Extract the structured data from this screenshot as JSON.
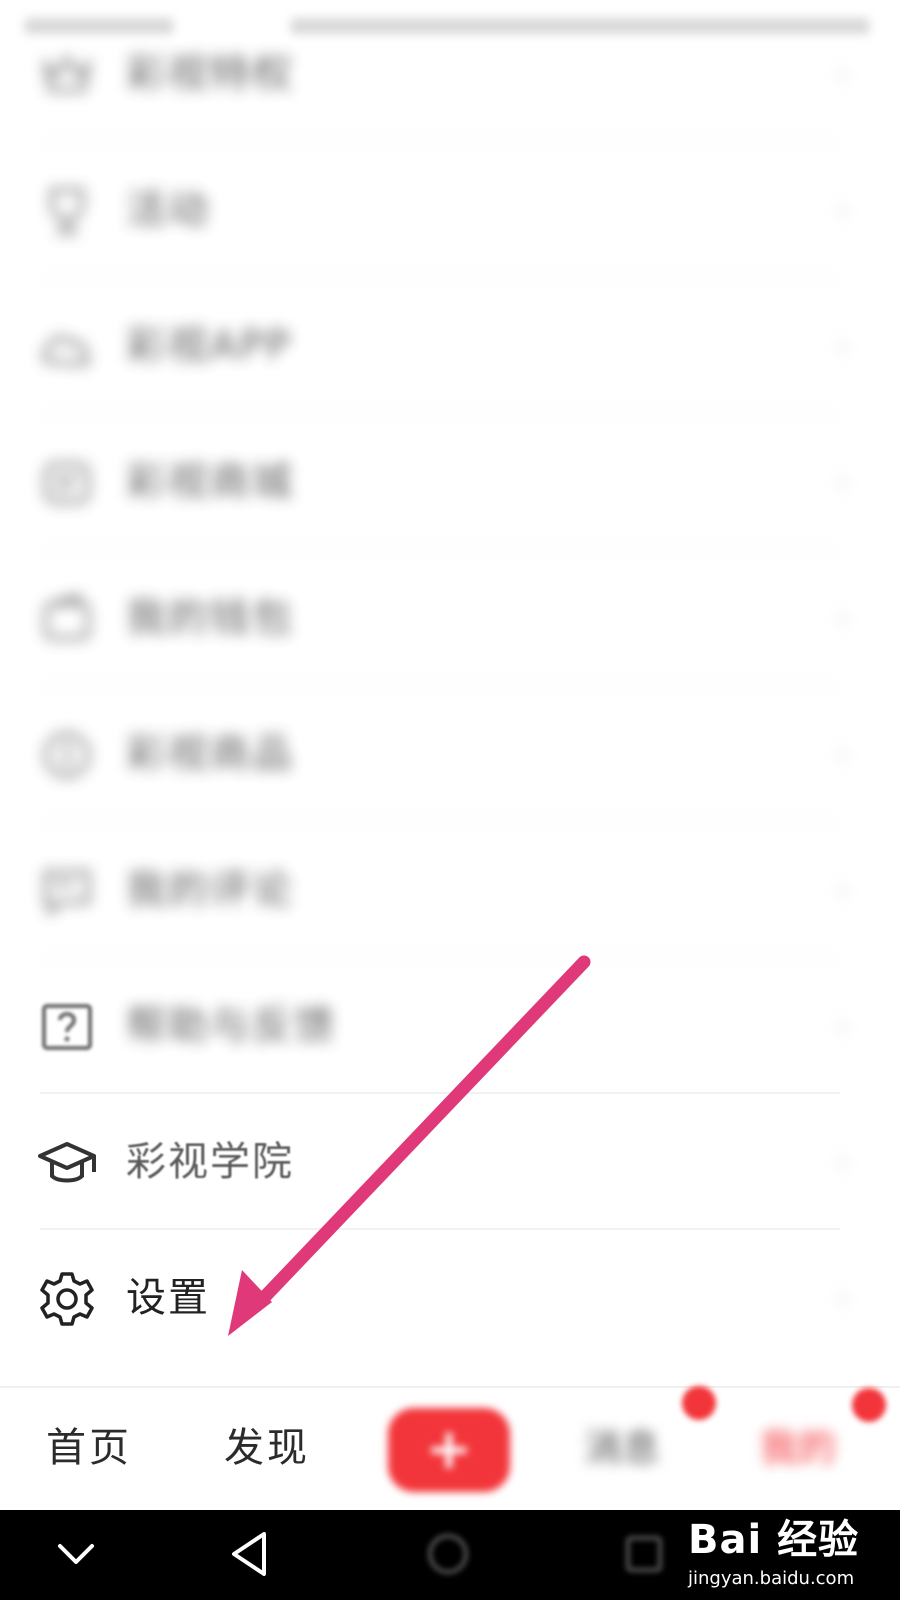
{
  "menu": {
    "items": [
      {
        "label": "彩视特权",
        "icon": "crown-icon",
        "clarity": "blurred"
      },
      {
        "label": "活动",
        "icon": "trophy-icon",
        "clarity": "blurred"
      },
      {
        "label": "彩视APP",
        "icon": "cloud-icon",
        "clarity": "blurred"
      },
      {
        "label": "彩视商城",
        "icon": "store-icon",
        "clarity": "blurred"
      },
      {
        "label": "我的钱包",
        "icon": "wallet-icon",
        "clarity": "blurred"
      },
      {
        "label": "彩视商品",
        "icon": "coin-icon",
        "clarity": "blurred"
      },
      {
        "label": "我的评论",
        "icon": "comment-icon",
        "clarity": "blurred"
      },
      {
        "label": "帮助与反馈",
        "icon": "help-icon",
        "clarity": "blurred"
      },
      {
        "label": "彩视学院",
        "icon": "graduation-cap-icon",
        "clarity": "soft"
      },
      {
        "label": "设置",
        "icon": "gear-icon",
        "clarity": "sharp"
      }
    ],
    "chevron": "›"
  },
  "tabbar": {
    "home": "首页",
    "discover": "发现",
    "create": "+",
    "messages": "消息",
    "me": "我的"
  },
  "annotation": {
    "color": "#e0397a",
    "points_to": "设置"
  },
  "watermark": {
    "logo": "Bai 经验",
    "url": "jingyan.baidu.com"
  },
  "colors": {
    "accent": "#f2353a",
    "text": "#2a2a2a"
  }
}
